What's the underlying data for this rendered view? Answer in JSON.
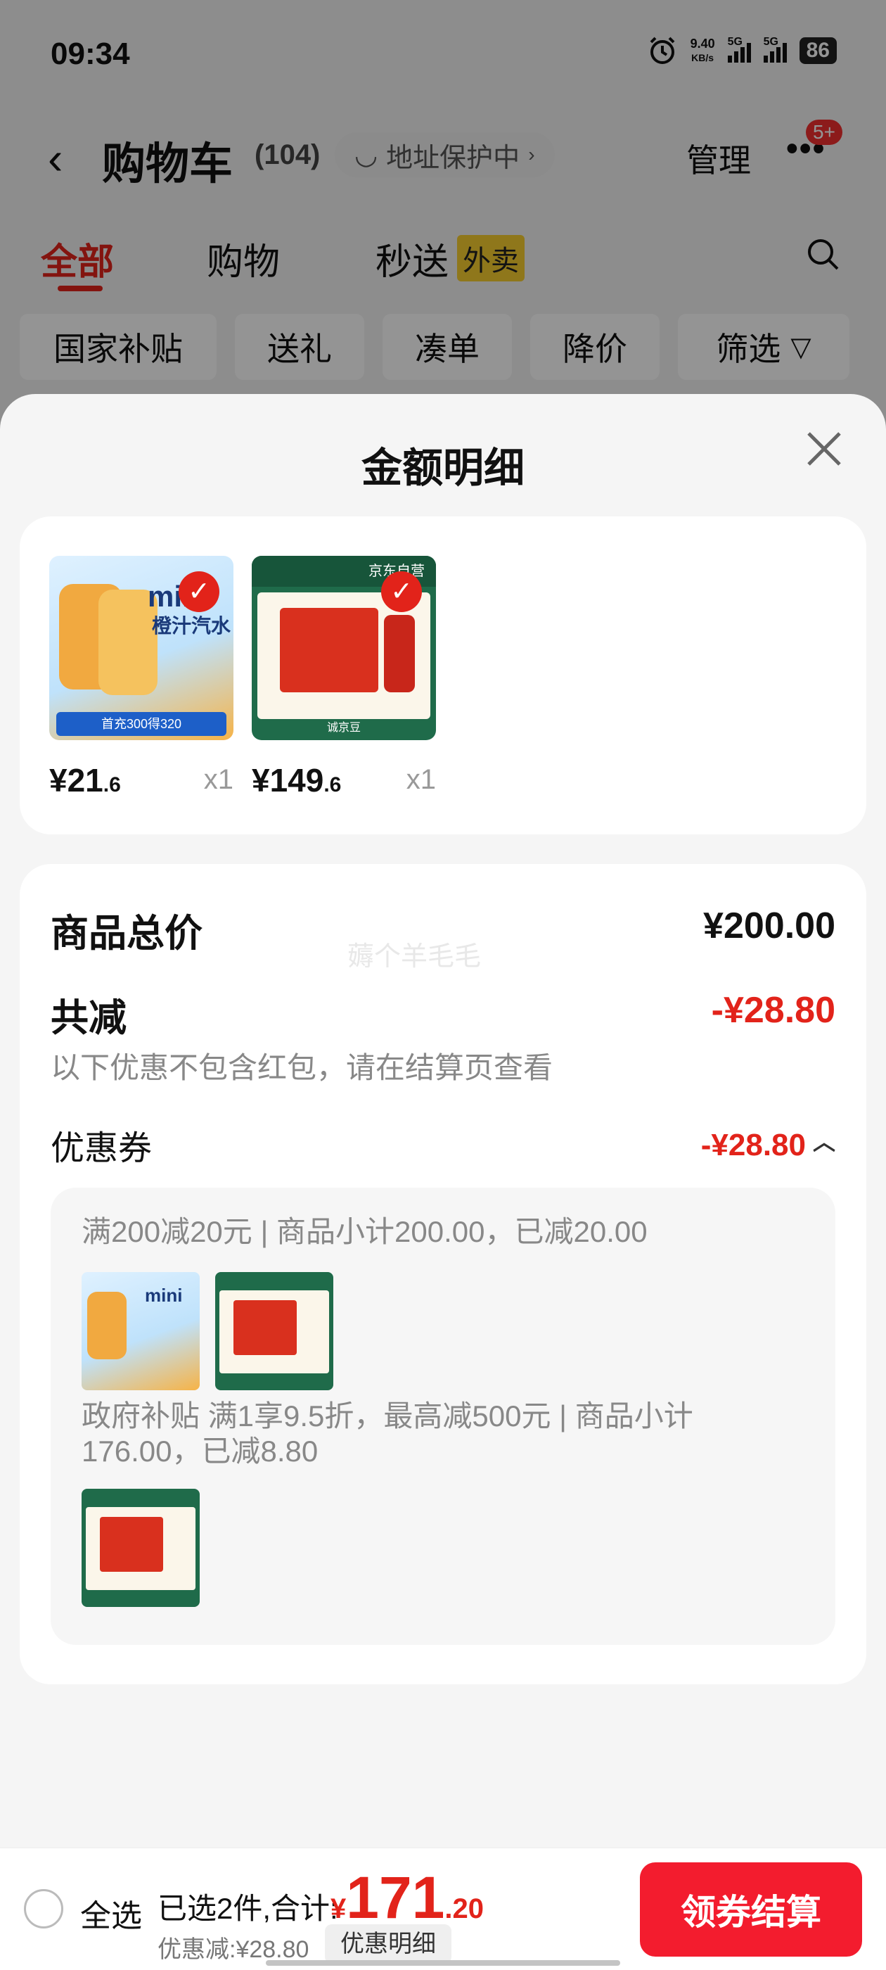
{
  "status_bar": {
    "time": "09:34",
    "net_speed_value": "9.40",
    "net_speed_unit": "KB/s",
    "sig1": "5G",
    "sig2": "5G",
    "battery": "86"
  },
  "header": {
    "title": "购物车",
    "count": "(104)",
    "address": "地址保护中",
    "manage": "管理",
    "badge": "5+"
  },
  "tabs": [
    {
      "label": "全部"
    },
    {
      "label": "购物"
    },
    {
      "label": "秒送"
    }
  ],
  "tab_badge": "外卖",
  "filters": [
    "国家补贴",
    "送礼",
    "凑单",
    "降价",
    "筛选"
  ],
  "sheet": {
    "title": "金额明细",
    "products": [
      {
        "price_int": "¥21",
        "price_dec": ".6",
        "qty": "x1",
        "img_text": "mini",
        "img_text2": "橙汁汽水",
        "img_sub": "首充300得320"
      },
      {
        "price_int": "¥149",
        "price_dec": ".6",
        "qty": "x1",
        "img_text": "京东自营",
        "img_sub": "诚京豆"
      }
    ],
    "total_label": "商品总价",
    "total_value": "¥200.00",
    "watermark": "薅个羊毛毛",
    "reduce_label": "共减",
    "reduce_value": "-¥28.80",
    "reduce_note": "以下优惠不包含红包，请在结算页查看",
    "coupon_label": "优惠券",
    "coupon_value": "-¥28.80",
    "coupon1_text": "满200减20元 | 商品小计200.00，已减20.00",
    "coupon2_text": "政府补贴 满1享9.5折，最高减500元 | 商品小计176.00，已减8.80"
  },
  "bottom": {
    "select_all": "全选",
    "selected_info": "已选2件,合计:",
    "total_yen": "¥",
    "total_int": "171",
    "total_dec": ".20",
    "discount": "优惠减:¥28.80",
    "detail_btn": "优惠明细",
    "checkout": "领券结算"
  },
  "colors": {
    "accent": "#e2231a",
    "checkout": "#f31c2e",
    "tab_badge": "#f7cd2f"
  }
}
